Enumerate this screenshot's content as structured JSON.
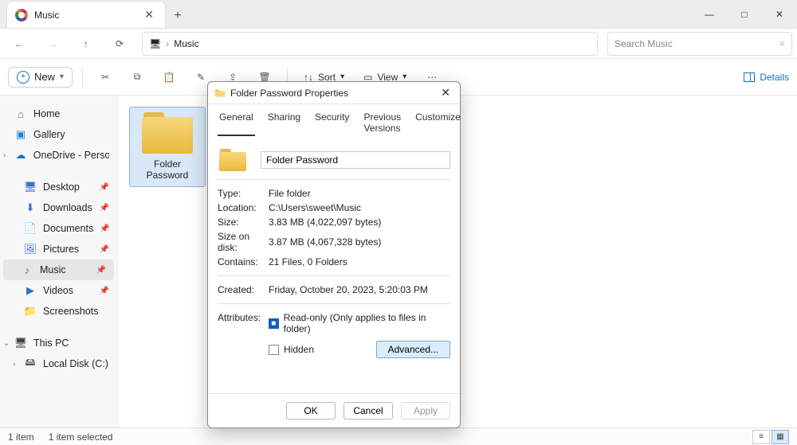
{
  "window": {
    "tab_title": "Music",
    "minimize": "—",
    "maximize": "□",
    "close": "✕",
    "new_tab": "+",
    "tab_close": "✕"
  },
  "nav": {
    "back": "←",
    "forward": "→",
    "up": "↑",
    "refresh": "⟳",
    "crumb_monitor": "▢",
    "crumb_current": "Music",
    "crumb_sep": "›"
  },
  "search": {
    "placeholder": "Search Music",
    "icon": "⌕"
  },
  "toolbar": {
    "new_label": "New",
    "sort_label": "Sort",
    "view_label": "View",
    "details_label": "Details"
  },
  "sidebar": {
    "home": "Home",
    "gallery": "Gallery",
    "onedrive": "OneDrive - Perso",
    "desktop": "Desktop",
    "downloads": "Downloads",
    "documents": "Documents",
    "pictures": "Pictures",
    "music": "Music",
    "videos": "Videos",
    "screenshots": "Screenshots",
    "this_pc": "This PC",
    "local_disk": "Local Disk (C:)"
  },
  "content": {
    "folder_name": "Folder Password"
  },
  "status": {
    "count": "1 item",
    "selected": "1 item selected"
  },
  "dialog": {
    "title": "Folder Password Properties",
    "tabs": {
      "general": "General",
      "sharing": "Sharing",
      "security": "Security",
      "previous": "Previous Versions",
      "customize": "Customize"
    },
    "name_value": "Folder Password",
    "type_label": "Type:",
    "type_value": "File folder",
    "location_label": "Location:",
    "location_value": "C:\\Users\\sweet\\Music",
    "size_label": "Size:",
    "size_value": "3.83 MB (4,022,097 bytes)",
    "size_disk_label": "Size on disk:",
    "size_disk_value": "3.87 MB (4,067,328 bytes)",
    "contains_label": "Contains:",
    "contains_value": "21 Files, 0 Folders",
    "created_label": "Created:",
    "created_value": "Friday, October 20, 2023, 5:20:03 PM",
    "attributes_label": "Attributes:",
    "readonly_label": "Read-only (Only applies to files in folder)",
    "hidden_label": "Hidden",
    "advanced_label": "Advanced...",
    "ok": "OK",
    "cancel": "Cancel",
    "apply": "Apply",
    "close_x": "✕"
  }
}
